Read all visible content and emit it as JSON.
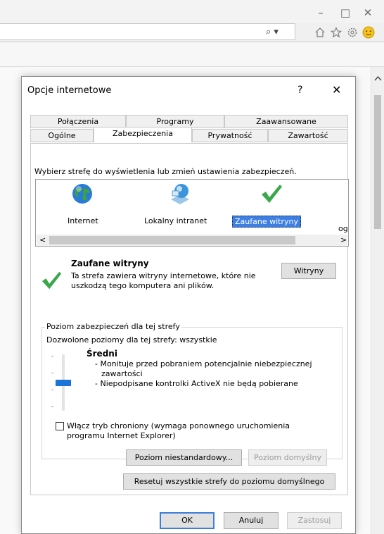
{
  "browser": {
    "window_controls": {
      "minimize": "–",
      "maximize": "□",
      "close": "✕"
    },
    "search_dropdown_glyph": "⌕ ▾",
    "toolbar_icons": [
      "home-icon",
      "favorites-star-icon",
      "settings-gear-icon",
      "smiley-feedback-icon"
    ]
  },
  "dialog": {
    "title": "Opcje internetowe",
    "help": "?",
    "close": "✕",
    "tabs_row1": [
      "Połączenia",
      "Programy",
      "Zaawansowane"
    ],
    "tabs_row2": [
      "Ogólne",
      "Zabezpieczenia",
      "Prywatność",
      "Zawartość"
    ],
    "active_tab": "Zabezpieczenia",
    "zone_prompt": "Wybierz strefę do wyświetlenia lub zmień ustawienia zabezpieczeń.",
    "zones": [
      {
        "label": "Internet",
        "icon": "globe-icon"
      },
      {
        "label": "Lokalny intranet",
        "icon": "intranet-icon"
      },
      {
        "label": "Zaufane witryny",
        "icon": "checkmark-icon",
        "selected": true
      }
    ],
    "cut_off_zone_text": "og",
    "scroll_left": "<",
    "scroll_right": ">",
    "zone_name": "Zaufane witryny",
    "zone_desc_line1": "Ta strefa zawiera witryny internetowe, które nie",
    "zone_desc_line2": "uszkodzą tego komputera ani plików.",
    "sites_button": "Witryny",
    "level_group_title": "Poziom zabezpieczeń dla tej strefy",
    "allowed_levels": "Dozwolone poziomy dla tej strefy: wszystkie",
    "level_name": "Średni",
    "level_desc1_a": "- Monituje przed pobraniem potencjalnie niebezpiecznej",
    "level_desc1_b": "zawartości",
    "level_desc2": "- Niepodpisane kontrolki ActiveX nie będą pobierane",
    "slider_level": "3 of 4 positions",
    "protected_mode_line1": "Włącz tryb chroniony (wymaga ponownego uruchomienia",
    "protected_mode_line2": "programu Internet Explorer)",
    "protected_mode_checked": false,
    "custom_level_button": "Poziom niestandardowy...",
    "default_level_button": "Poziom domyślny",
    "reset_all_button": "Resetuj wszystkie strefy do poziomu domyślnego",
    "ok_button": "OK",
    "cancel_button": "Anuluj",
    "apply_button": "Zastosuj"
  },
  "colors": {
    "selection": "#3d7fe3",
    "check_green": "#3aa84a",
    "slider_thumb": "#1e73d6"
  }
}
